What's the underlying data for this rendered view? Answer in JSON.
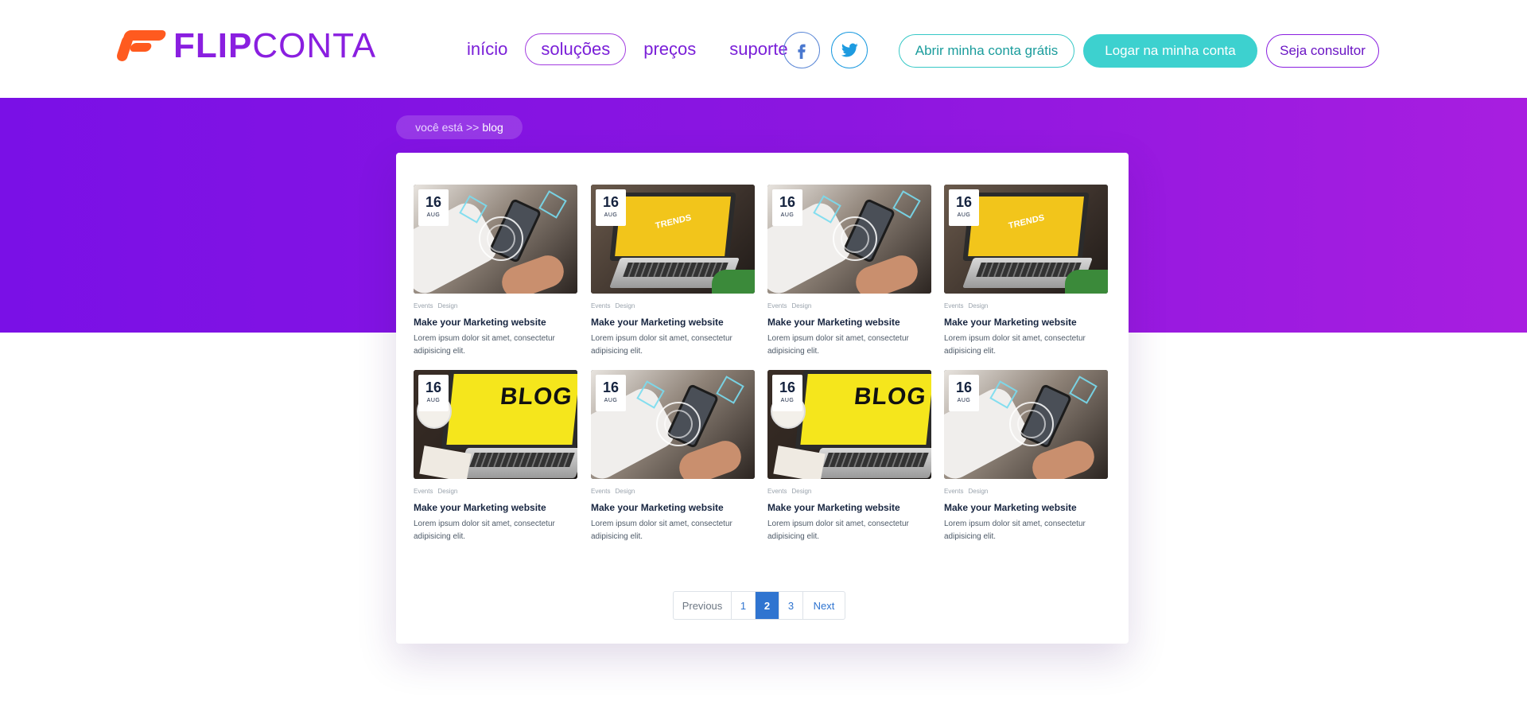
{
  "brand": {
    "name_bold": "FLIP",
    "name_light": "CONTA",
    "color": "#8a1fe0",
    "accent": "#ff5a1f"
  },
  "nav": {
    "items": [
      {
        "label": "início",
        "active": false
      },
      {
        "label": "soluções",
        "active": true
      },
      {
        "label": "preços",
        "active": false
      },
      {
        "label": "suporte",
        "active": false
      }
    ]
  },
  "social": {
    "facebook_icon": "facebook-icon",
    "twitter_icon": "twitter-icon"
  },
  "header_buttons": {
    "open_account": "Abrir minha conta grátis",
    "login": "Logar na minha conta",
    "consultant": "Seja consultor"
  },
  "breadcrumb": {
    "prefix": "você está >>",
    "current": "blog"
  },
  "posts": [
    {
      "day": "16",
      "month": "AUG",
      "tags": [
        "Events",
        "Design"
      ],
      "title": "Make your Marketing website",
      "excerpt": "Lorem ipsum dolor sit amet, consectetur adipisicing elit.",
      "image": "phone"
    },
    {
      "day": "16",
      "month": "AUG",
      "tags": [
        "Events",
        "Design"
      ],
      "title": "Make your Marketing website",
      "excerpt": "Lorem ipsum dolor sit amet, consectetur adipisicing elit.",
      "image": "trends",
      "image_text": "TRENDS"
    },
    {
      "day": "16",
      "month": "AUG",
      "tags": [
        "Events",
        "Design"
      ],
      "title": "Make your Marketing website",
      "excerpt": "Lorem ipsum dolor sit amet, consectetur adipisicing elit.",
      "image": "phone"
    },
    {
      "day": "16",
      "month": "AUG",
      "tags": [
        "Events",
        "Design"
      ],
      "title": "Make your Marketing website",
      "excerpt": "Lorem ipsum dolor sit amet, consectetur adipisicing elit.",
      "image": "trends",
      "image_text": "TRENDS"
    },
    {
      "day": "16",
      "month": "AUG",
      "tags": [
        "Events",
        "Design"
      ],
      "title": "Make your Marketing website",
      "excerpt": "Lorem ipsum dolor sit amet, consectetur adipisicing elit.",
      "image": "blog",
      "image_text": "BLOG"
    },
    {
      "day": "16",
      "month": "AUG",
      "tags": [
        "Events",
        "Design"
      ],
      "title": "Make your Marketing website",
      "excerpt": "Lorem ipsum dolor sit amet, consectetur adipisicing elit.",
      "image": "phone"
    },
    {
      "day": "16",
      "month": "AUG",
      "tags": [
        "Events",
        "Design"
      ],
      "title": "Make your Marketing website",
      "excerpt": "Lorem ipsum dolor sit amet, consectetur adipisicing elit.",
      "image": "blog",
      "image_text": "BLOG"
    },
    {
      "day": "16",
      "month": "AUG",
      "tags": [
        "Events",
        "Design"
      ],
      "title": "Make your Marketing website",
      "excerpt": "Lorem ipsum dolor sit amet, consectetur adipisicing elit.",
      "image": "phone"
    }
  ],
  "pagination": {
    "previous": "Previous",
    "pages": [
      "1",
      "2",
      "3"
    ],
    "current": "2",
    "next": "Next"
  },
  "colors": {
    "band_start": "#7a10e6",
    "band_end": "#a81ee0",
    "teal": "#3dd1cf",
    "link_blue": "#2f74d0"
  }
}
